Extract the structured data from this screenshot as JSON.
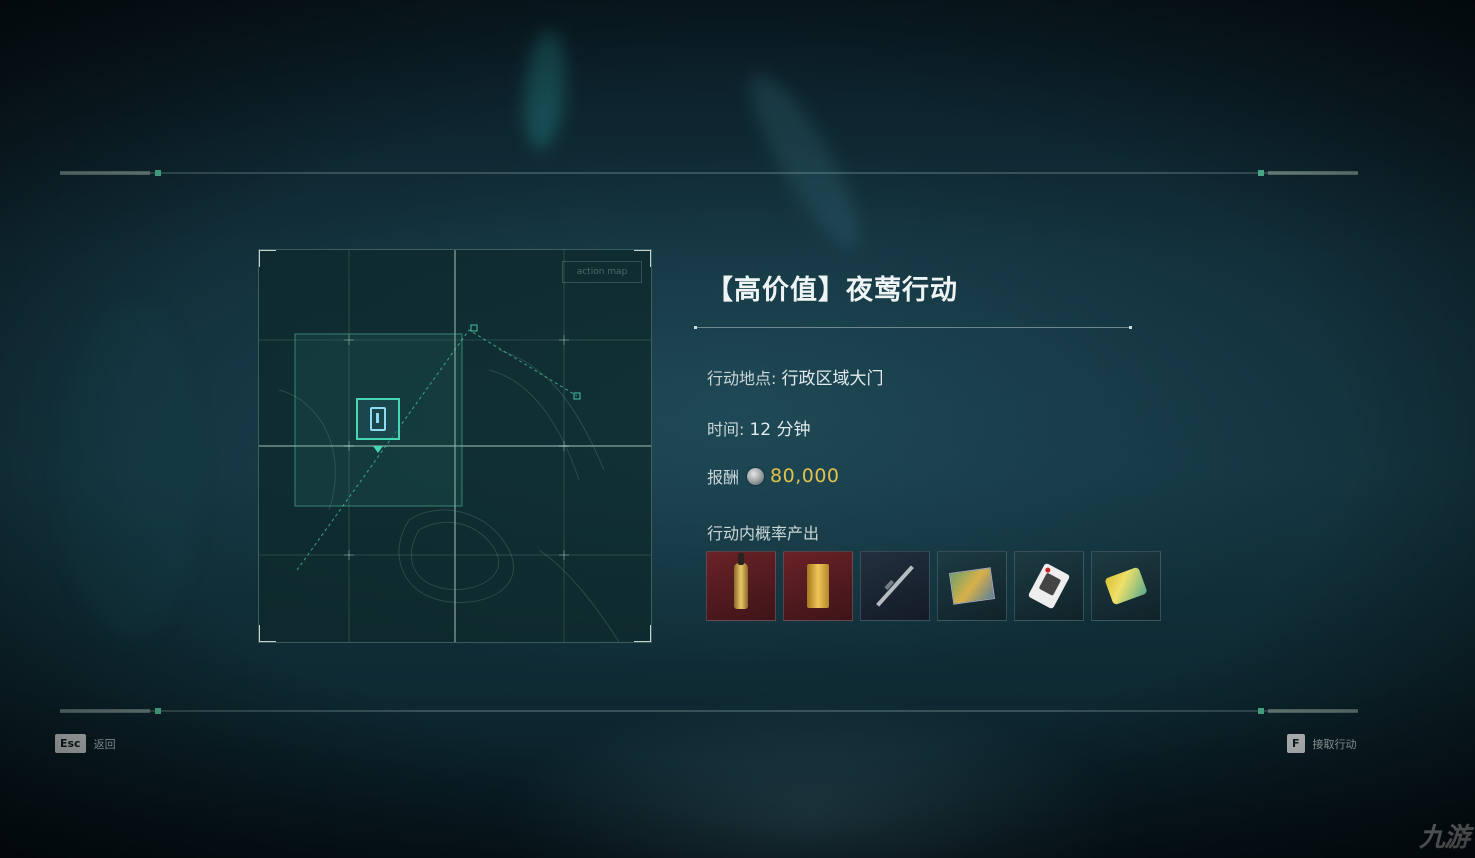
{
  "mission": {
    "title": "【高价值】夜莺行动",
    "location_label": "行动地点: ",
    "location_value": "行政区域大门",
    "time_label": "时间: ",
    "time_value": "12 分钟",
    "reward_label": "报酬",
    "reward_value": "80,000",
    "drops_label": "行动内概率产出"
  },
  "map": {
    "corner_label": "action map"
  },
  "items": [
    {
      "icon": "champagne-bottle-icon",
      "rarity_color": "#6a2227"
    },
    {
      "icon": "gold-bar-icon",
      "rarity_color": "#6a2227"
    },
    {
      "icon": "rifle-icon",
      "rarity_color": "#22303f"
    },
    {
      "icon": "painting-icon",
      "rarity_color": "#1d3a42"
    },
    {
      "icon": "playing-card-icon",
      "rarity_color": "#1d3a42"
    },
    {
      "icon": "snack-bag-icon",
      "rarity_color": "#1d3a42"
    }
  ],
  "footer": {
    "esc_key": "Esc",
    "esc_label": "返回",
    "f_key": "F",
    "f_label": "接取行动"
  },
  "watermark": "九游",
  "colors": {
    "accent": "#47d6b4",
    "reward_gold": "#e0c24c",
    "background": "#143540"
  }
}
